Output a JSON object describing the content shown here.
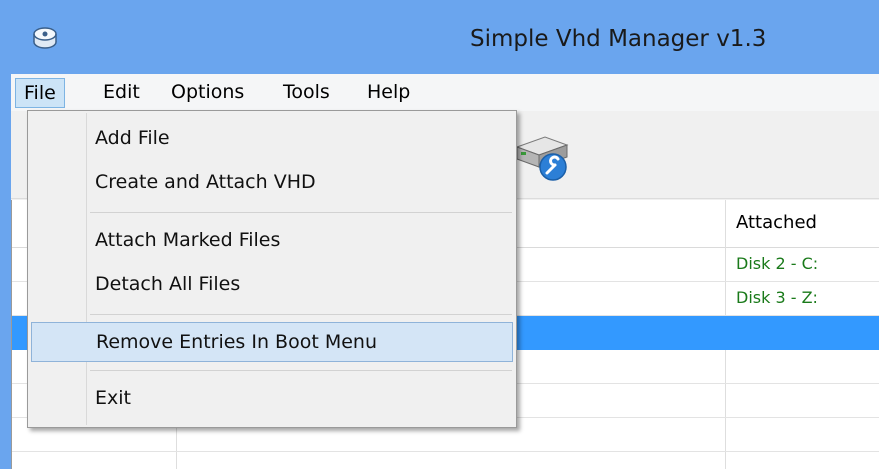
{
  "window": {
    "title": "Simple Vhd Manager v1.3",
    "app_icon": "disk-app-icon"
  },
  "menubar": {
    "items": [
      "File",
      "Edit",
      "Options",
      "Tools",
      "Help"
    ],
    "active": "File"
  },
  "toolbar": {
    "icon": "drive-settings-icon"
  },
  "grid": {
    "columns": [
      {
        "label": "Attached"
      }
    ],
    "rows": [
      {
        "attached": "Disk 2  -  C:"
      },
      {
        "attached": "Disk 3  -  Z:"
      },
      {
        "attached": "",
        "selected": true
      },
      {
        "attached": ""
      },
      {
        "attached": ""
      },
      {
        "attached": ""
      }
    ]
  },
  "file_menu": {
    "items": [
      {
        "label": "Add File"
      },
      {
        "label": "Create and Attach VHD"
      },
      {
        "label": "Attach Marked Files"
      },
      {
        "label": "Detach All Files"
      },
      {
        "label": "Remove Entries In Boot Menu",
        "highlighted": true
      },
      {
        "label": "Exit"
      }
    ]
  },
  "colors": {
    "titlebar": "#6aa5ee",
    "selection": "#3399ff",
    "menu_hover": "#d4e5f6",
    "attached_text": "#1a7a1a"
  }
}
